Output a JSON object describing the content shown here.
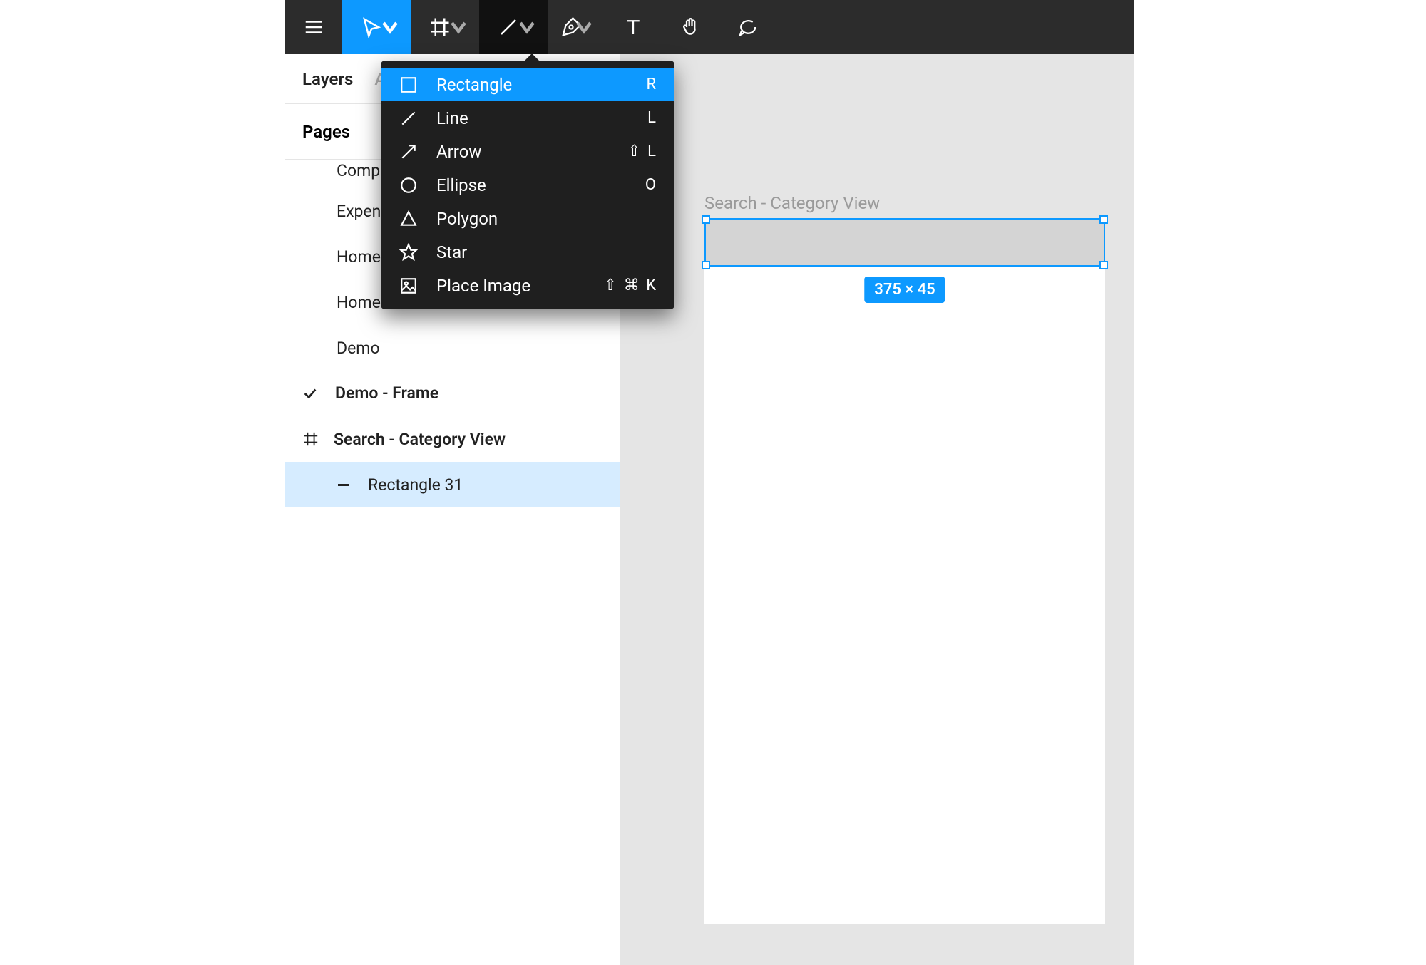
{
  "sidebar": {
    "tabs": {
      "layers": "Layers",
      "assets_initial": "A"
    },
    "pages_label": "Pages",
    "items": [
      {
        "label": "Comp…"
      },
      {
        "label": "Expen…"
      },
      {
        "label": "Home"
      },
      {
        "label": "Home"
      },
      {
        "label": "Demo"
      }
    ],
    "demo_frame": "Demo - Frame",
    "current_frame": "Search - Category View",
    "selected_layer": "Rectangle 31"
  },
  "canvas": {
    "frame_label": "Search - Category View",
    "dimensions_badge": "375 × 45"
  },
  "shape_menu": {
    "items": [
      {
        "label": "Rectangle",
        "shortcut": "R",
        "highlighted": true,
        "icon": "rectangle"
      },
      {
        "label": "Line",
        "shortcut": "L",
        "icon": "line"
      },
      {
        "label": "Arrow",
        "shortcut": "⇧ L",
        "icon": "arrow"
      },
      {
        "label": "Ellipse",
        "shortcut": "O",
        "icon": "ellipse"
      },
      {
        "label": "Polygon",
        "shortcut": "",
        "icon": "polygon"
      },
      {
        "label": "Star",
        "shortcut": "",
        "icon": "star"
      },
      {
        "label": "Place Image",
        "shortcut": "⇧ ⌘ K",
        "icon": "image"
      }
    ]
  }
}
